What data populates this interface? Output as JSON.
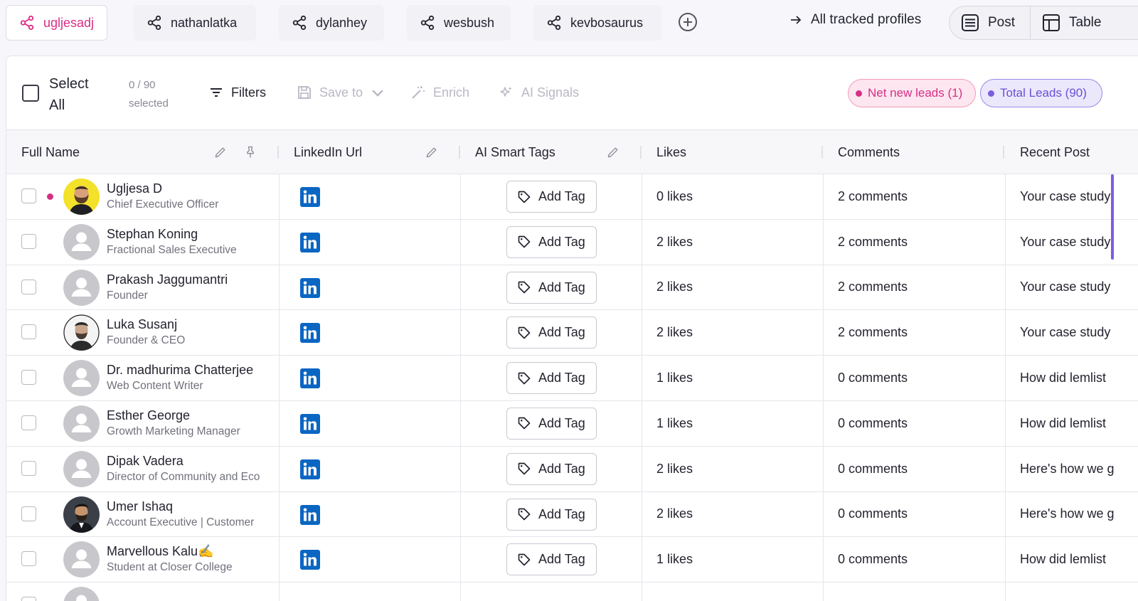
{
  "profile_tabs": [
    {
      "label": "ugljesadj",
      "active": true
    },
    {
      "label": "nathanlatka",
      "active": false
    },
    {
      "label": "dylanhey",
      "active": false
    },
    {
      "label": "wesbush",
      "active": false
    },
    {
      "label": "kevbosaurus",
      "active": false
    }
  ],
  "all_tracked_label": "All tracked profiles",
  "view_toggle": {
    "post_label": "Post",
    "table_label": "Table"
  },
  "toolbar": {
    "select_all_label": "Select All",
    "selected_count": "0 / 90",
    "selected_word": "selected",
    "filters_label": "Filters",
    "save_to_label": "Save to",
    "enrich_label": "Enrich",
    "ai_signals_label": "AI Signals",
    "net_new_leads": "Net new leads (1)",
    "total_leads": "Total Leads (90)"
  },
  "columns": {
    "full_name": "Full Name",
    "linkedin_url": "LinkedIn Url",
    "ai_smart_tags": "AI Smart Tags",
    "likes": "Likes",
    "comments": "Comments",
    "recent_post": "Recent Post"
  },
  "add_tag_label": "Add Tag",
  "accent_colors": {
    "pink": "#d62f86",
    "purple": "#7c5de0",
    "linkedin": "#0a66c2"
  },
  "rows": [
    {
      "name": "Ugljesa D",
      "title": "Chief Executive Officer",
      "likes": "0 likes",
      "comments": "2 comments",
      "recent": "Your case study",
      "new": true,
      "avatar": "photo-yellow"
    },
    {
      "name": "Stephan Koning",
      "title": "Fractional Sales Executive",
      "likes": "2 likes",
      "comments": "2 comments",
      "recent": "Your case study",
      "new": false,
      "avatar": "placeholder"
    },
    {
      "name": "Prakash Jaggumantri",
      "title": "Founder",
      "likes": "2 likes",
      "comments": "2 comments",
      "recent": "Your case study",
      "new": false,
      "avatar": "placeholder"
    },
    {
      "name": "Luka Susanj",
      "title": "Founder & CEO",
      "likes": "2 likes",
      "comments": "2 comments",
      "recent": "Your case study",
      "new": false,
      "avatar": "photo-light"
    },
    {
      "name": "Dr. madhurima Chatterjee",
      "title": "Web Content Writer",
      "likes": "1 likes",
      "comments": "0 comments",
      "recent": "How did lemlist",
      "new": false,
      "avatar": "placeholder"
    },
    {
      "name": "Esther George",
      "title": "Growth Marketing Manager",
      "likes": "1 likes",
      "comments": "0 comments",
      "recent": "How did lemlist",
      "new": false,
      "avatar": "placeholder"
    },
    {
      "name": "Dipak Vadera",
      "title": "Director of Community and Eco",
      "likes": "2 likes",
      "comments": "0 comments",
      "recent": "Here's how we g",
      "new": false,
      "avatar": "placeholder"
    },
    {
      "name": "Umer Ishaq",
      "title": "Account Executive | Customer",
      "likes": "2 likes",
      "comments": "0 comments",
      "recent": "Here's how we g",
      "new": false,
      "avatar": "photo-dark"
    },
    {
      "name": "Marvellous Kalu✍️",
      "title": "Student at Closer College",
      "likes": "1 likes",
      "comments": "0 comments",
      "recent": "How did lemlist",
      "new": false,
      "avatar": "placeholder"
    },
    {
      "name": "",
      "title": "",
      "likes": "",
      "comments": "",
      "recent": "",
      "new": false,
      "avatar": "placeholder"
    }
  ]
}
